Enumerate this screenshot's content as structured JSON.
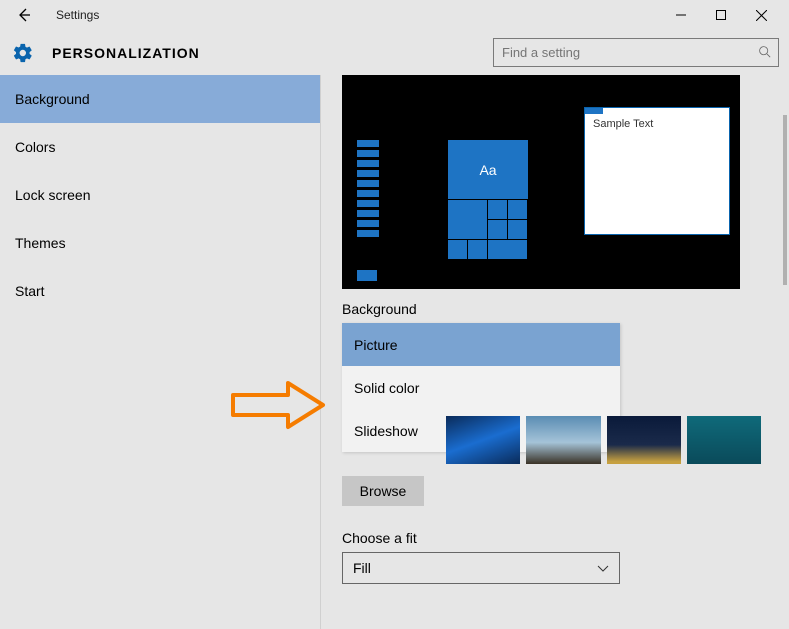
{
  "window": {
    "app_title": "Settings"
  },
  "header": {
    "page_title": "PERSONALIZATION",
    "search_placeholder": "Find a setting"
  },
  "sidebar": {
    "items": [
      {
        "label": "Background",
        "selected": true
      },
      {
        "label": "Colors",
        "selected": false
      },
      {
        "label": "Lock screen",
        "selected": false
      },
      {
        "label": "Themes",
        "selected": false
      },
      {
        "label": "Start",
        "selected": false
      }
    ]
  },
  "main": {
    "preview": {
      "sample_text": "Sample Text",
      "tile_text": "Aa"
    },
    "background_label": "Background",
    "background_dropdown": {
      "options": [
        {
          "label": "Picture",
          "selected": true
        },
        {
          "label": "Solid color",
          "selected": false
        },
        {
          "label": "Slideshow",
          "selected": false
        }
      ]
    },
    "browse_label": "Browse",
    "fit_label": "Choose a fit",
    "fit_value": "Fill"
  },
  "colors": {
    "accent": "#1e74c4",
    "sidebar_selected": "#87abd8",
    "dropdown_selected": "#7aa3d1",
    "annotation": "#f57c00"
  }
}
